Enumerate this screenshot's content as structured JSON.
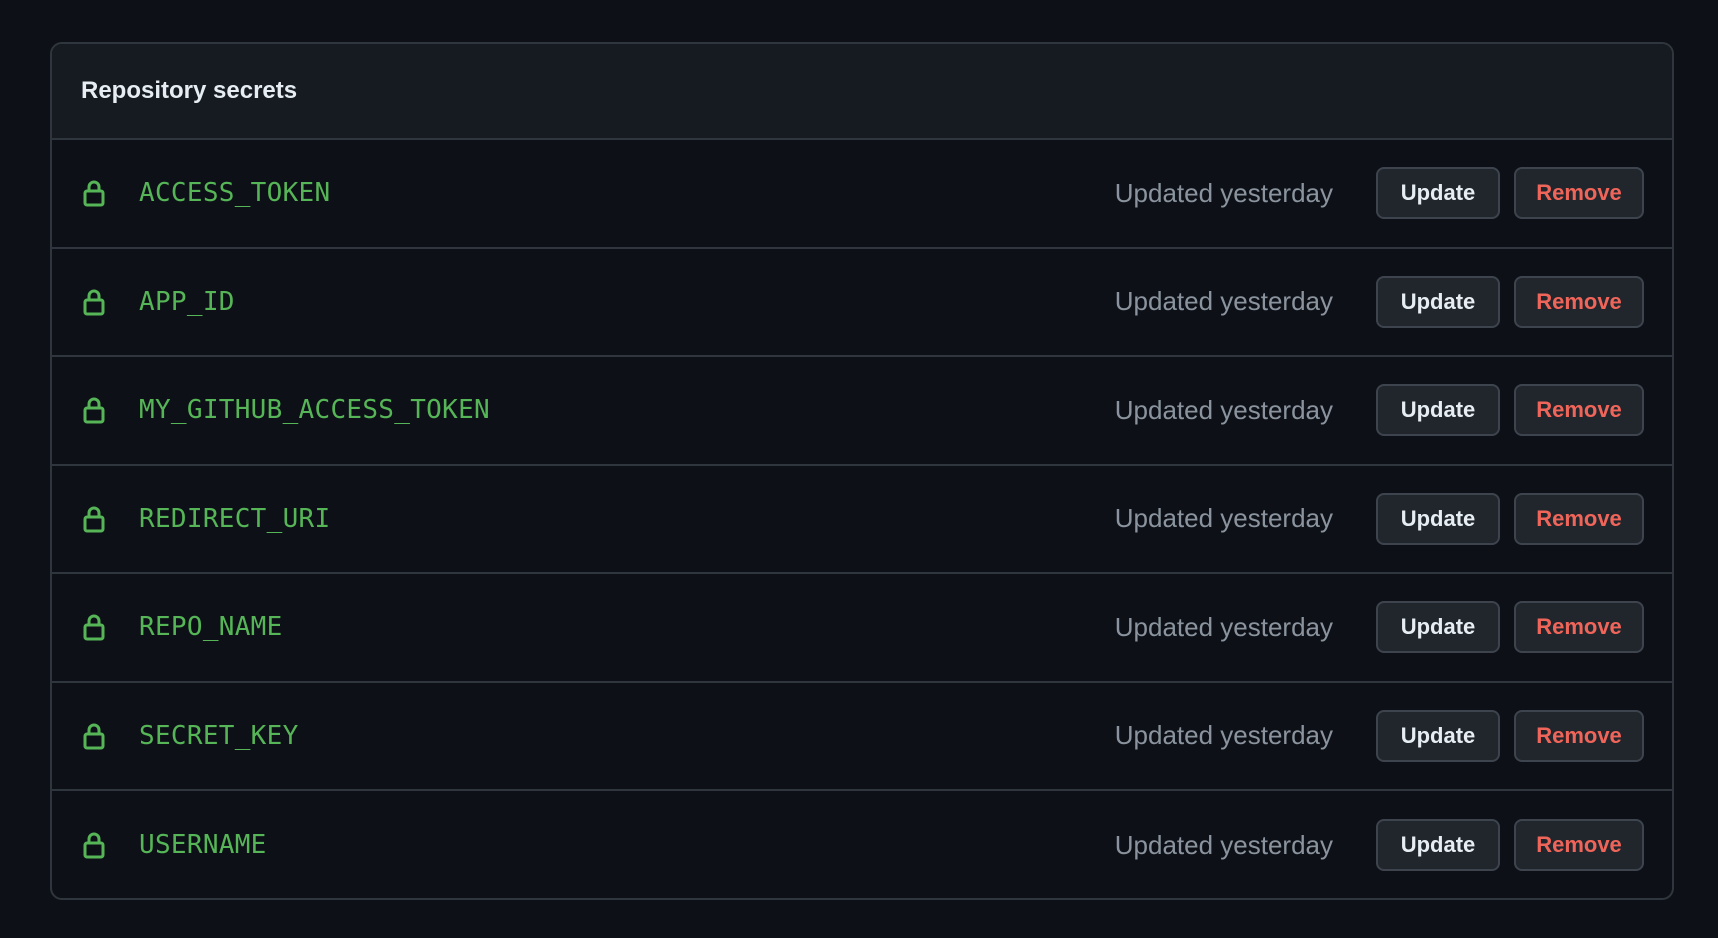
{
  "header": {
    "title": "Repository secrets"
  },
  "colors": {
    "secret_name": "#56b557",
    "remove_text": "#f0655a",
    "background": "#0d1117",
    "header_bg": "#161b22",
    "border": "#30363d"
  },
  "icons": {
    "row_icon": "lock-icon"
  },
  "secrets": [
    {
      "name": "ACCESS_TOKEN",
      "updated": "Updated yesterday",
      "update_label": "Update",
      "remove_label": "Remove"
    },
    {
      "name": "APP_ID",
      "updated": "Updated yesterday",
      "update_label": "Update",
      "remove_label": "Remove"
    },
    {
      "name": "MY_GITHUB_ACCESS_TOKEN",
      "updated": "Updated yesterday",
      "update_label": "Update",
      "remove_label": "Remove"
    },
    {
      "name": "REDIRECT_URI",
      "updated": "Updated yesterday",
      "update_label": "Update",
      "remove_label": "Remove"
    },
    {
      "name": "REPO_NAME",
      "updated": "Updated yesterday",
      "update_label": "Update",
      "remove_label": "Remove"
    },
    {
      "name": "SECRET_KEY",
      "updated": "Updated yesterday",
      "update_label": "Update",
      "remove_label": "Remove"
    },
    {
      "name": "USERNAME",
      "updated": "Updated yesterday",
      "update_label": "Update",
      "remove_label": "Remove"
    }
  ]
}
